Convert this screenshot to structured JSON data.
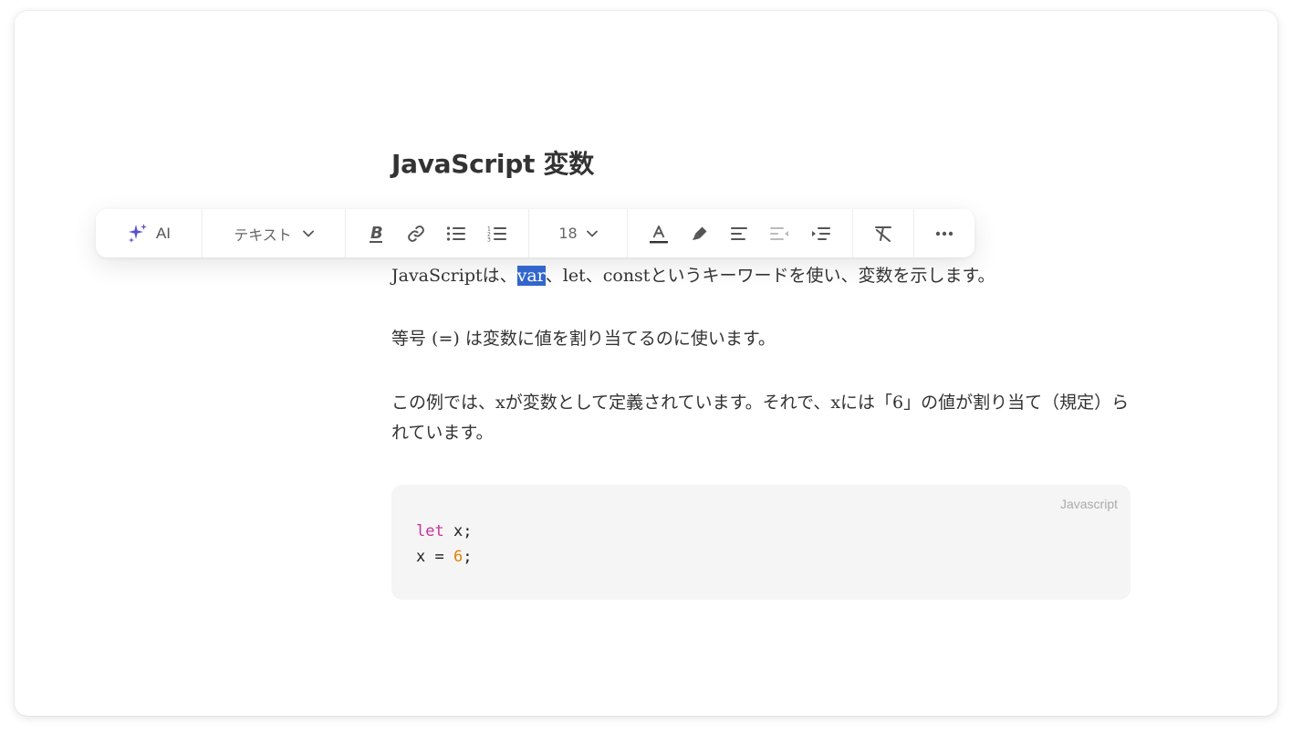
{
  "document": {
    "title": "JavaScript 変数"
  },
  "toolbar": {
    "ai_label": "AI",
    "block_type": "テキスト",
    "font_size": "18",
    "colors": {
      "ai_icon": "#5b4fd6",
      "icon": "#555555"
    },
    "icons": [
      "sparkles-icon",
      "chevron-down-icon",
      "bold-icon",
      "link-icon",
      "bullet-list-icon",
      "numbered-list-icon",
      "text-color-icon",
      "highlighter-icon",
      "align-left-icon",
      "outdent-icon",
      "indent-icon",
      "clear-format-icon",
      "more-icon"
    ]
  },
  "paragraphs": {
    "p1_before": "JavaScriptは、",
    "p1_selected": "var",
    "p1_after": "、let、constというキーワードを使い、変数を示します。",
    "p2": "等号 (=) は変数に値を割り当てるのに使います。",
    "p3": "この例では、xが変数として定義されています。それで、xには「6」の値が割り当て（規定）られています。"
  },
  "code": {
    "language": "Javascript",
    "line1_kw": "let",
    "line1_rest": " x;",
    "line2_pre": "x = ",
    "line2_num": "6",
    "line2_post": ";",
    "colors": {
      "keyword": "#c8329b",
      "number": "#e0820a",
      "background": "#f5f5f5"
    }
  },
  "selection_color": "#3366cc"
}
